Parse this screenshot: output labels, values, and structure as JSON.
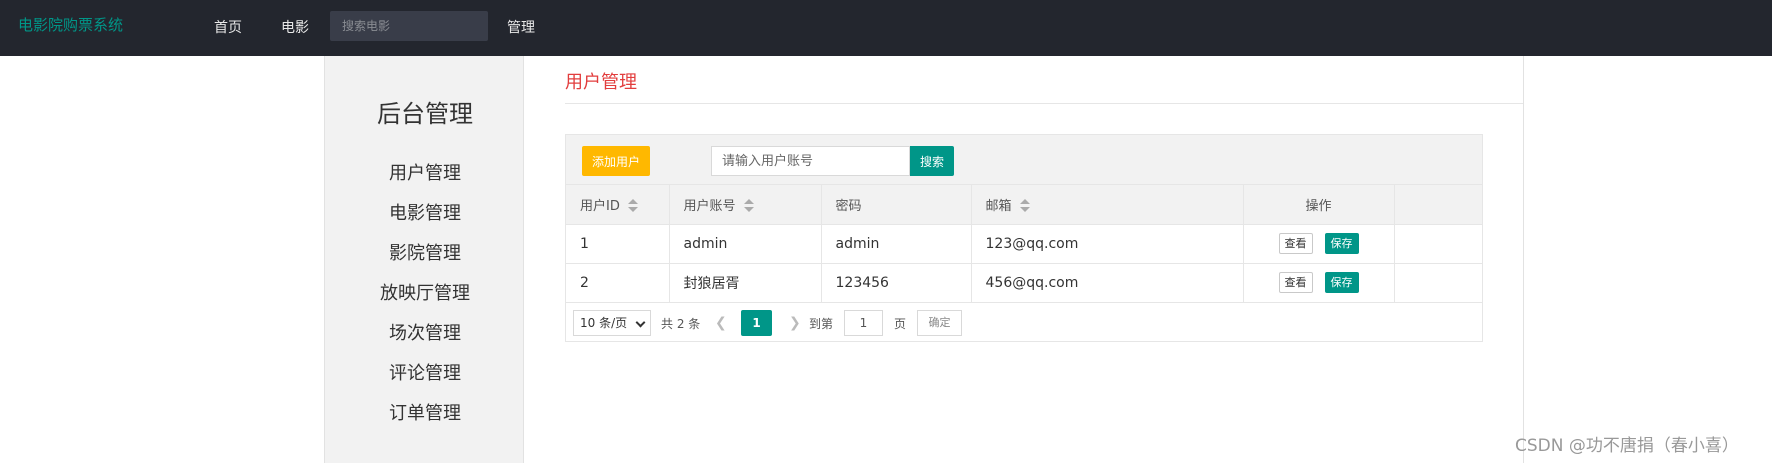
{
  "nav": {
    "brand": "电影院购票系统",
    "home": "首页",
    "movie": "电影",
    "search_placeholder": "搜索电影",
    "admin": "管理"
  },
  "sidebar": {
    "title": "后台管理",
    "items": [
      {
        "label": "用户管理"
      },
      {
        "label": "电影管理"
      },
      {
        "label": "影院管理"
      },
      {
        "label": "放映厅管理"
      },
      {
        "label": "场次管理"
      },
      {
        "label": "评论管理"
      },
      {
        "label": "订单管理"
      }
    ]
  },
  "main": {
    "title": "用户管理",
    "toolbar": {
      "add_label": "添加用户",
      "search_placeholder": "请输入用户账号",
      "search_label": "搜索"
    },
    "table": {
      "headers": [
        "用户ID",
        "用户账号",
        "密码",
        "邮箱",
        "操作"
      ],
      "rows": [
        {
          "id": "1",
          "account": "admin",
          "password": "admin",
          "email": "123@qq.com",
          "view": "查看",
          "save": "保存"
        },
        {
          "id": "2",
          "account": "封狼居胥",
          "password": "123456",
          "email": "456@qq.com",
          "view": "查看",
          "save": "保存"
        }
      ]
    },
    "pagination": {
      "page_size": "10 条/页",
      "total": "共 2 条",
      "current": "1",
      "goto": "到第",
      "goto_value": "1",
      "page_unit": "页",
      "confirm": "确定"
    }
  },
  "watermark": "CSDN @功不唐捐（春小喜）",
  "colors": {
    "nav_bg": "#23262e",
    "brand": "#009688",
    "accent": "#009688",
    "warn": "#ffb800",
    "title_red": "#e23d3d"
  }
}
